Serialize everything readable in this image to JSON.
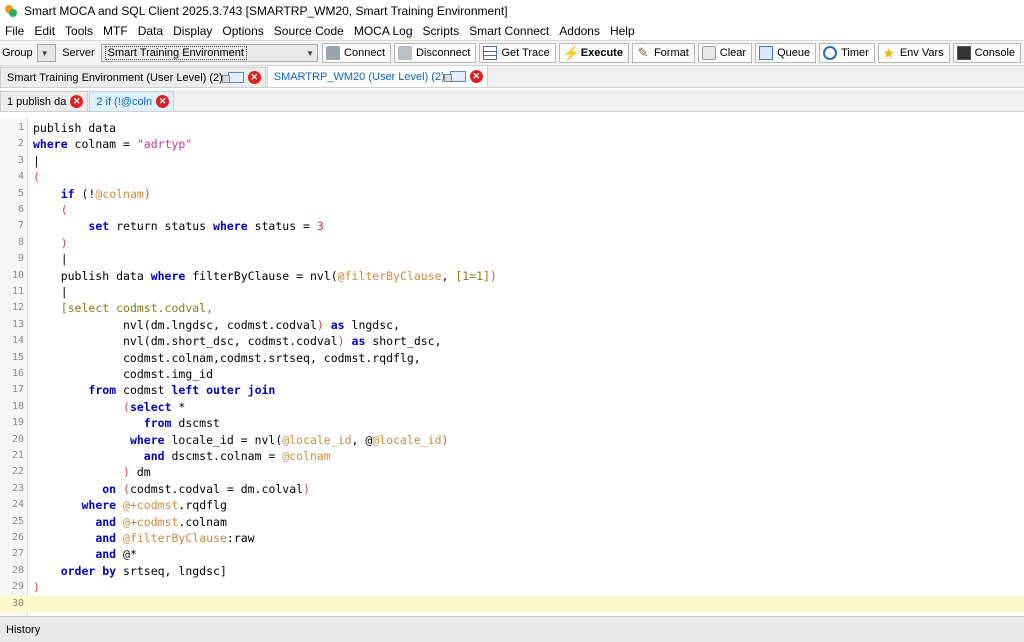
{
  "window": {
    "title": "Smart MOCA and SQL Client 2025.3.743 [SMARTRP_WM20, Smart Training Environment]"
  },
  "menu": [
    "File",
    "Edit",
    "Tools",
    "MTF",
    "Data",
    "Display",
    "Options",
    "Source Code",
    "MOCA Log",
    "Scripts",
    "Smart Connect",
    "Addons",
    "Help"
  ],
  "toolbar": {
    "group_label": "Group",
    "server_label": "Server",
    "server_value": "Smart Training Environment",
    "buttons": [
      {
        "label": "Connect",
        "icon": "plug-icon"
      },
      {
        "label": "Disconnect",
        "icon": "unplug-icon"
      },
      {
        "label": "Get Trace",
        "icon": "trace-icon"
      },
      {
        "label": "Execute",
        "icon": "lightning-icon"
      },
      {
        "label": "Format",
        "icon": "wand-icon"
      },
      {
        "label": "Clear",
        "icon": "eraser-icon"
      },
      {
        "label": "Queue",
        "icon": "queue-icon"
      },
      {
        "label": "Timer",
        "icon": "timer-icon"
      },
      {
        "label": "Env Vars",
        "icon": "star-icon"
      },
      {
        "label": "Console",
        "icon": "console-icon"
      }
    ]
  },
  "connection_tabs": [
    {
      "label": "Smart Training Environment (User Level) (2)",
      "active": false
    },
    {
      "label": "SMARTRP_WM20 (User Level) (2)",
      "active": true
    }
  ],
  "query_tabs": [
    {
      "label": "1 publish da",
      "active": false
    },
    {
      "label": "2 if (!@coln",
      "active": true
    }
  ],
  "editor": {
    "current_line": 30,
    "lines": [
      {
        "n": "1",
        "parts": [
          [
            "pl",
            "publish data"
          ]
        ]
      },
      {
        "n": "2",
        "parts": [
          [
            "kw",
            "where"
          ],
          [
            "pl",
            " colnam = "
          ],
          [
            "str",
            "\"adrtyp\""
          ]
        ]
      },
      {
        "n": "3",
        "parts": [
          [
            "pl",
            "|"
          ]
        ]
      },
      {
        "n": "4",
        "parts": [
          [
            "par",
            "("
          ]
        ]
      },
      {
        "n": "5",
        "parts": [
          [
            "pl",
            "    "
          ],
          [
            "kw",
            "if"
          ],
          [
            "pl",
            " ("
          ],
          [
            "pl",
            "!"
          ],
          [
            "var",
            "@colnam"
          ],
          [
            "par",
            ")"
          ]
        ]
      },
      {
        "n": "6",
        "parts": [
          [
            "pl",
            "    "
          ],
          [
            "par",
            "("
          ]
        ]
      },
      {
        "n": "7",
        "parts": [
          [
            "pl",
            "        "
          ],
          [
            "kw",
            "set"
          ],
          [
            "pl",
            " return status "
          ],
          [
            "kw",
            "where"
          ],
          [
            "pl",
            " status = "
          ],
          [
            "num",
            "3"
          ]
        ]
      },
      {
        "n": "8",
        "parts": [
          [
            "pl",
            "    "
          ],
          [
            "par",
            ")"
          ]
        ]
      },
      {
        "n": "9",
        "parts": [
          [
            "pl",
            "    |"
          ]
        ]
      },
      {
        "n": "10",
        "parts": [
          [
            "pl",
            "    publish data "
          ],
          [
            "kw",
            "where"
          ],
          [
            "pl",
            " filterByClause = nvl("
          ],
          [
            "var",
            "@filterByClause"
          ],
          [
            "pl",
            ", "
          ],
          [
            "sq",
            "[1=1]"
          ],
          [
            "par",
            ")"
          ]
        ]
      },
      {
        "n": "11",
        "parts": [
          [
            "pl",
            "    |"
          ]
        ]
      },
      {
        "n": "12",
        "parts": [
          [
            "pl",
            "    "
          ],
          [
            "sq",
            "[select codmst.codval,"
          ]
        ]
      },
      {
        "n": "13",
        "parts": [
          [
            "pl",
            "             nvl("
          ],
          [
            "pl",
            "dm.lngdsc, codmst.codval"
          ],
          [
            "par",
            ")"
          ],
          [
            "pl",
            " "
          ],
          [
            "kw",
            "as"
          ],
          [
            "pl",
            " lngdsc,"
          ]
        ]
      },
      {
        "n": "14",
        "parts": [
          [
            "pl",
            "             nvl("
          ],
          [
            "pl",
            "dm.short_dsc, codmst.codval"
          ],
          [
            "par",
            ")"
          ],
          [
            "pl",
            " "
          ],
          [
            "kw",
            "as"
          ],
          [
            "pl",
            " short_dsc,"
          ]
        ]
      },
      {
        "n": "15",
        "parts": [
          [
            "pl",
            "             codmst.colnam,codmst.srtseq, codmst.rqdflg,"
          ]
        ]
      },
      {
        "n": "16",
        "parts": [
          [
            "pl",
            "             codmst.img_id"
          ]
        ]
      },
      {
        "n": "17",
        "parts": [
          [
            "pl",
            "        "
          ],
          [
            "kw",
            "from"
          ],
          [
            "pl",
            " codmst "
          ],
          [
            "kw",
            "left outer join"
          ]
        ]
      },
      {
        "n": "18",
        "parts": [
          [
            "pl",
            "             "
          ],
          [
            "par",
            "("
          ],
          [
            "kw",
            "select"
          ],
          [
            "pl",
            " *"
          ]
        ]
      },
      {
        "n": "19",
        "parts": [
          [
            "pl",
            "                "
          ],
          [
            "kw",
            "from"
          ],
          [
            "pl",
            " dscmst"
          ]
        ]
      },
      {
        "n": "20",
        "parts": [
          [
            "pl",
            "              "
          ],
          [
            "kw",
            "where"
          ],
          [
            "pl",
            " locale_id = nvl("
          ],
          [
            "var",
            "@locale_id"
          ],
          [
            "pl",
            ", @"
          ],
          [
            "var",
            "@locale_id"
          ],
          [
            "par",
            ")"
          ]
        ]
      },
      {
        "n": "21",
        "parts": [
          [
            "pl",
            "                "
          ],
          [
            "kw",
            "and"
          ],
          [
            "pl",
            " dscmst.colnam = "
          ],
          [
            "var",
            "@colnam"
          ]
        ]
      },
      {
        "n": "22",
        "parts": [
          [
            "pl",
            "             "
          ],
          [
            "par",
            ")"
          ],
          [
            "pl",
            " dm"
          ]
        ]
      },
      {
        "n": "23",
        "parts": [
          [
            "pl",
            "          "
          ],
          [
            "kw",
            "on"
          ],
          [
            "pl",
            " "
          ],
          [
            "par",
            "("
          ],
          [
            "pl",
            "codmst.codval = dm.colval"
          ],
          [
            "par",
            ")"
          ]
        ]
      },
      {
        "n": "24",
        "parts": [
          [
            "pl",
            "       "
          ],
          [
            "kw",
            "where"
          ],
          [
            "pl",
            " "
          ],
          [
            "var",
            "@+codmst"
          ],
          [
            "pl",
            ".rqdflg"
          ]
        ]
      },
      {
        "n": "25",
        "parts": [
          [
            "pl",
            "         "
          ],
          [
            "kw",
            "and"
          ],
          [
            "pl",
            " "
          ],
          [
            "var",
            "@+codmst"
          ],
          [
            "pl",
            ".colnam"
          ]
        ]
      },
      {
        "n": "26",
        "parts": [
          [
            "pl",
            "         "
          ],
          [
            "kw",
            "and"
          ],
          [
            "pl",
            " "
          ],
          [
            "var",
            "@filterByClause"
          ],
          [
            "pl",
            ":raw"
          ]
        ]
      },
      {
        "n": "27",
        "parts": [
          [
            "pl",
            "         "
          ],
          [
            "kw",
            "and"
          ],
          [
            "pl",
            " @*"
          ]
        ]
      },
      {
        "n": "28",
        "parts": [
          [
            "pl",
            "    "
          ],
          [
            "kw",
            "order by"
          ],
          [
            "pl",
            " srtseq, lngdsc]"
          ]
        ]
      },
      {
        "n": "29",
        "parts": [
          [
            "par",
            ")"
          ]
        ]
      },
      {
        "n": "30",
        "parts": []
      }
    ]
  },
  "history": {
    "label": "History"
  }
}
